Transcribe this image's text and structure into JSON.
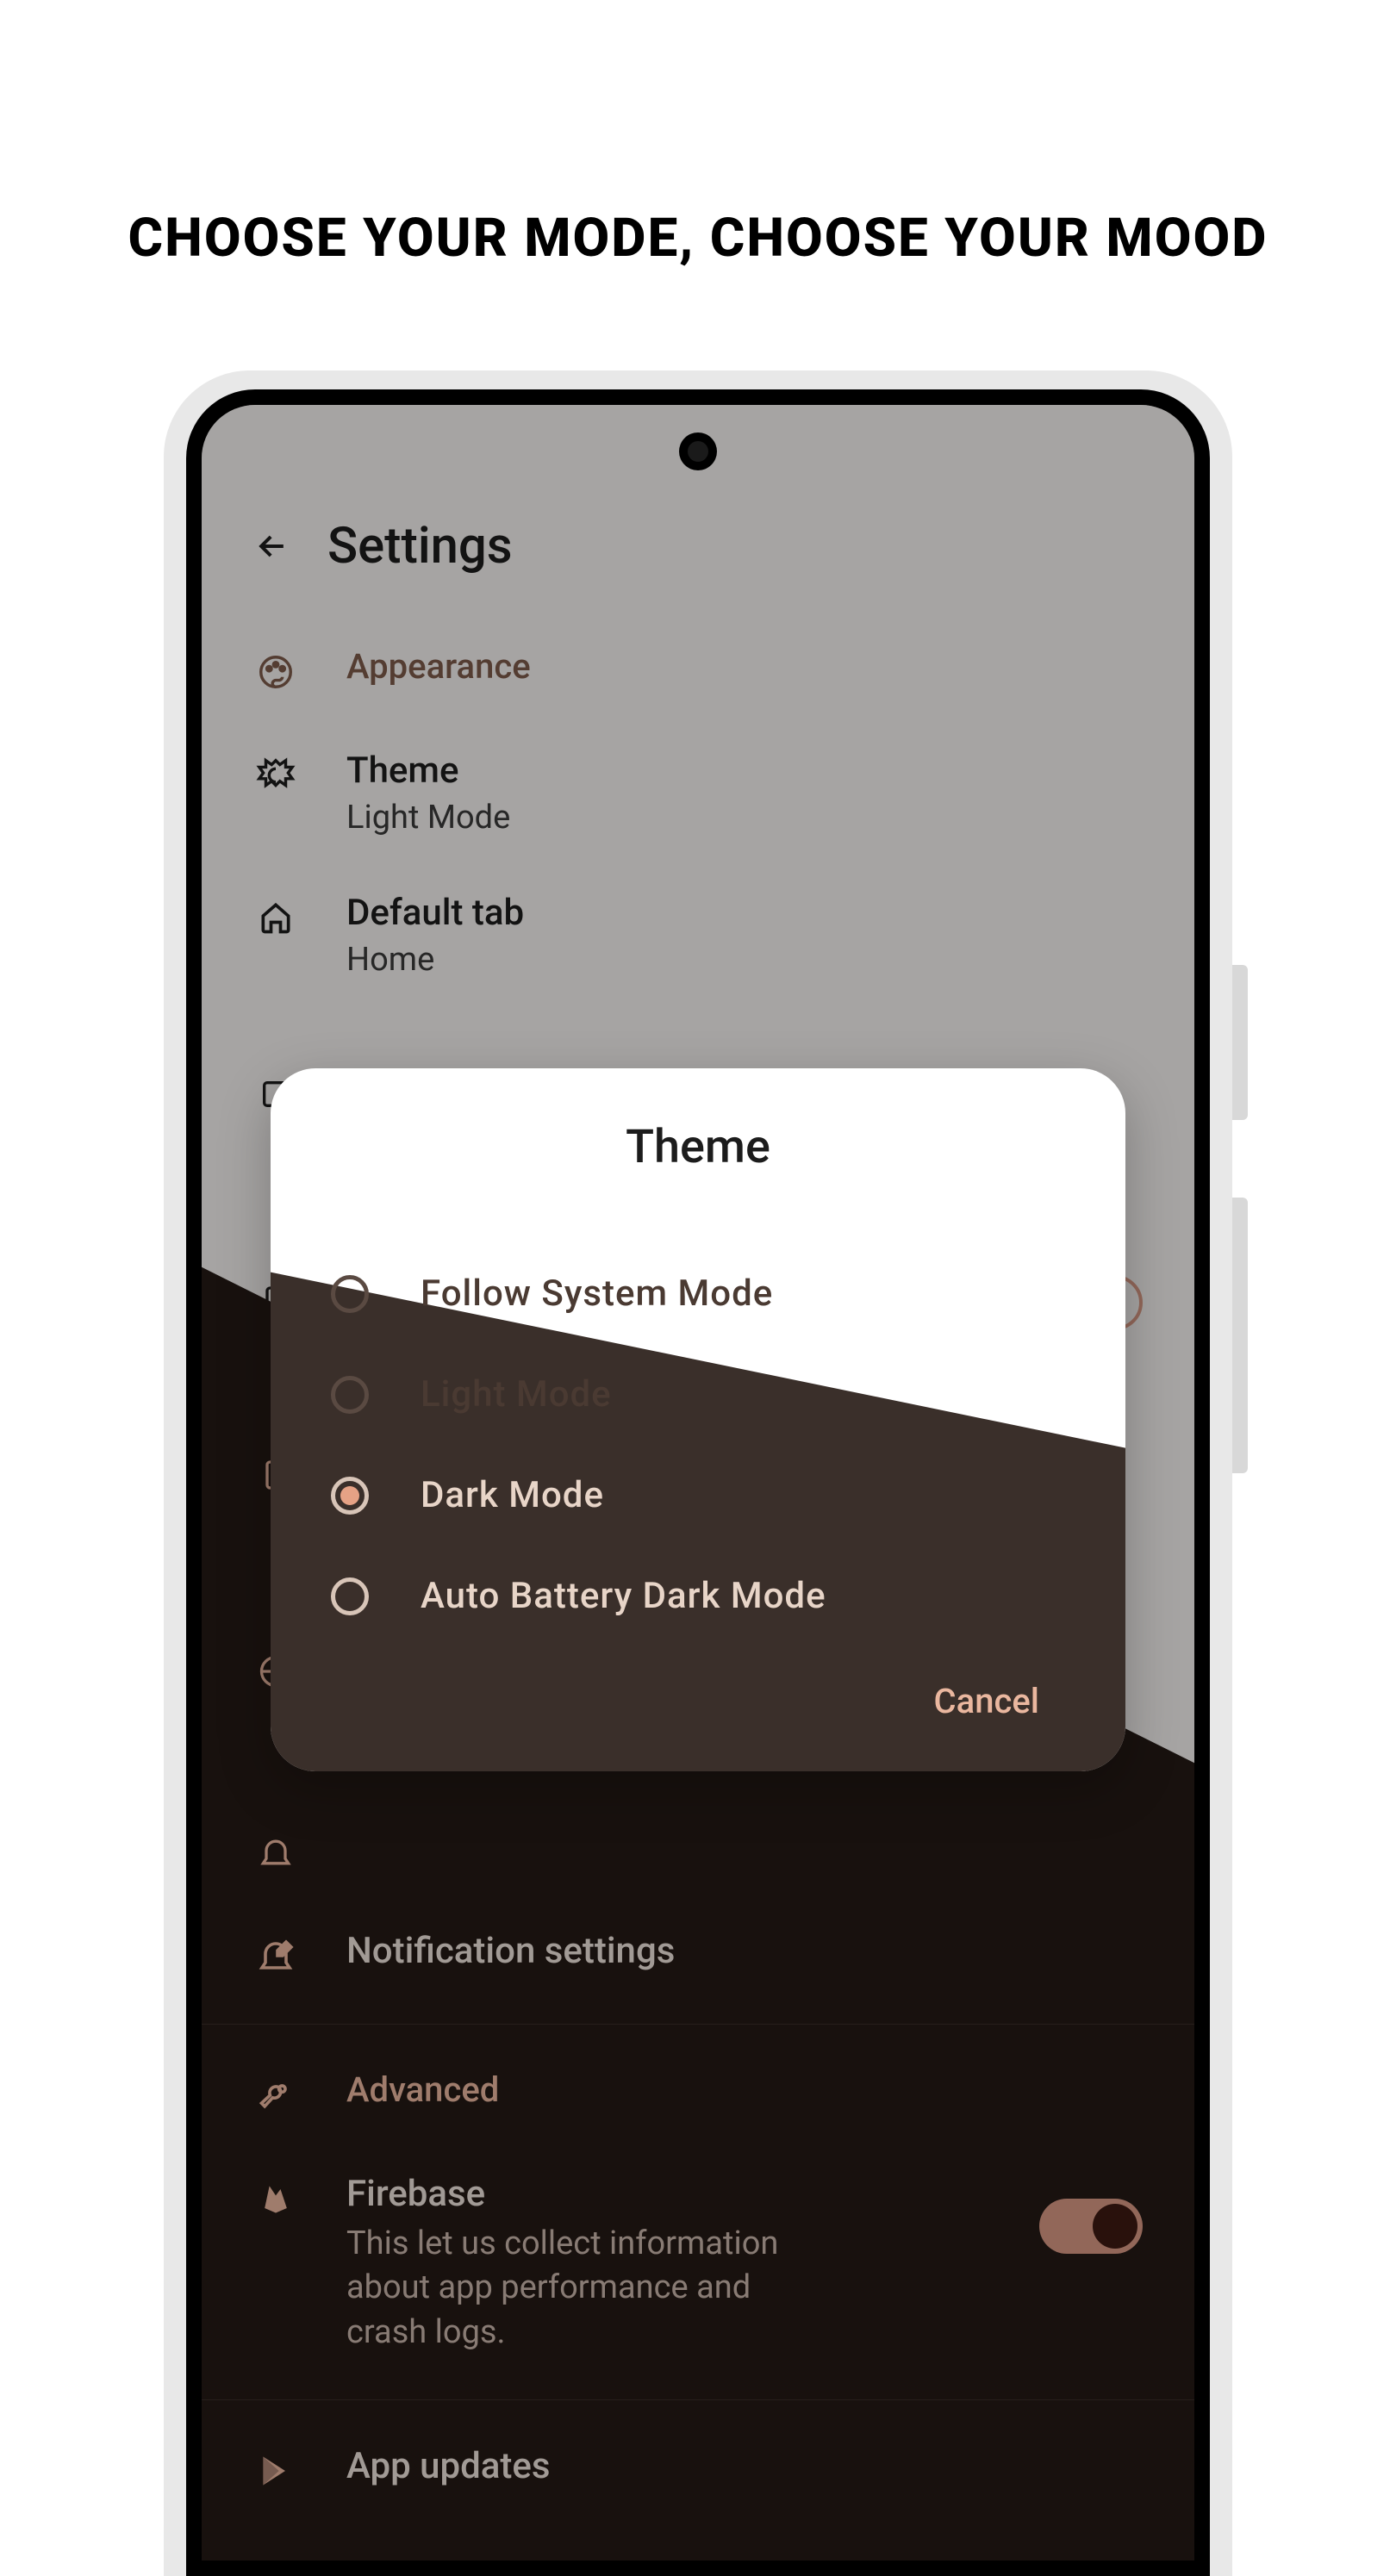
{
  "headline": "CHOOSE YOUR MODE, CHOOSE YOUR MOOD",
  "page": {
    "title": "Settings",
    "sections": {
      "appearance": {
        "label": "Appearance"
      },
      "advanced": {
        "label": "Advanced"
      }
    },
    "items": {
      "theme": {
        "title": "Theme",
        "value": "Light Mode"
      },
      "default_tab": {
        "title": "Default tab",
        "value": "Home"
      },
      "notification_settings": {
        "title": "Notification settings"
      },
      "firebase": {
        "title": "Firebase",
        "desc": "This let us collect information about app performance and crash logs."
      },
      "app_updates": {
        "title": "App updates"
      }
    }
  },
  "dialog": {
    "title": "Theme",
    "options": [
      {
        "label": "Follow System Mode",
        "selected": false
      },
      {
        "label": "Light Mode",
        "selected": false
      },
      {
        "label": "Dark Mode",
        "selected": true
      },
      {
        "label": "Auto Battery Dark Mode",
        "selected": false
      }
    ],
    "cancel": "Cancel"
  },
  "colors": {
    "accent": "#eab79f",
    "dark_bg": "#241a16",
    "light_bg": "#f5f2f0"
  }
}
